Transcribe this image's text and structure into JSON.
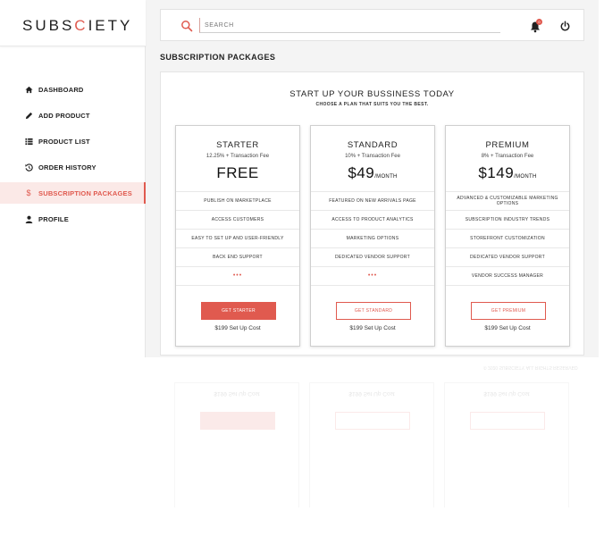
{
  "brand": {
    "prefix": "SUBS",
    "accent": "C",
    "suffix": "IETY",
    "accent_color": "#e05a4f"
  },
  "sidebar": {
    "items": [
      {
        "label": "DASHBOARD",
        "icon": "home-icon",
        "active": false
      },
      {
        "label": "ADD PRODUCT",
        "icon": "pencil-icon",
        "active": false
      },
      {
        "label": "PRODUCT LIST",
        "icon": "list-icon",
        "active": false
      },
      {
        "label": "ORDER HISTORY",
        "icon": "history-icon",
        "active": false
      },
      {
        "label": "SUBSCRIPTION PACKAGES",
        "icon": "dollar-icon",
        "active": true
      },
      {
        "label": "PROFILE",
        "icon": "user-icon",
        "active": false
      }
    ]
  },
  "topbar": {
    "search_placeholder": "SEARCH",
    "notification_count": "0",
    "icons": [
      "search-icon",
      "bell-icon",
      "power-icon"
    ]
  },
  "page": {
    "title": "SUBSCRIPTION PACKAGES",
    "heading": "START UP YOUR BUSSINESS TODAY",
    "subheading": "CHOOSE A PLAN THAT SUITS YOU THE BEST."
  },
  "plans": [
    {
      "name": "STARTER",
      "fee": "12.25% + Transaction Fee",
      "price": "FREE",
      "per": "",
      "features": [
        "PUBLISH ON MARKETPLACE",
        "ACCESS CUSTOMERS",
        "EASY TO SET UP AND USER-FRIENDLY",
        "BACK END SUPPORT",
        "•••"
      ],
      "cta": "GET STARTER",
      "setup": "$199 Set Up Cost"
    },
    {
      "name": "STANDARD",
      "fee": "10% + Transaction Fee",
      "price": "$49",
      "per": "/MONTH",
      "features": [
        "FEATURED ON NEW ARRIVALS PAGE",
        "ACCESS TO PRODUCT ANALYTICS",
        "MARKETING OPTIONS",
        "DEDICATED VENDOR SUPPORT",
        "•••"
      ],
      "cta": "GET STANDARD",
      "setup": "$199 Set Up Cost"
    },
    {
      "name": "PREMIUM",
      "fee": "8% + Transaction Fee",
      "price": "$149",
      "per": "/MONTH",
      "features": [
        "ADVANCED & CUSTOMIZABLE MARKETING OPTIONS",
        "SUBSCRIPTION INDUSTRY TRENDS",
        "STOREFRONT CUSTOMIZATION",
        "DEDICATED VENDOR SUPPORT",
        "VENDOR SUCCESS MANAGER"
      ],
      "cta": "GET PREMIUM",
      "setup": "$199 Set Up Cost"
    }
  ],
  "footer": "© 2020 SUBSCIETY. ALL RIGHTS RESERVED"
}
